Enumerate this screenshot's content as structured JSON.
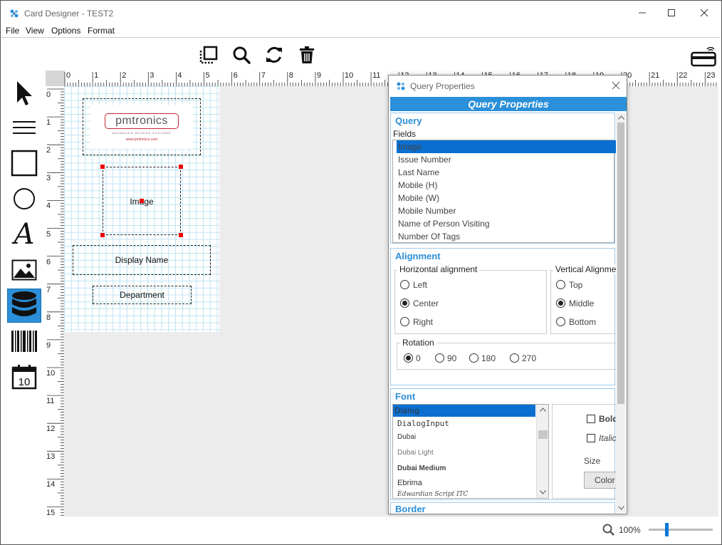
{
  "window": {
    "title": "Card Designer - TEST2"
  },
  "menu": [
    "File",
    "View",
    "Options",
    "Format"
  ],
  "toolbar": [
    "select-area-icon",
    "zoom-icon",
    "refresh-icon",
    "delete-icon"
  ],
  "tools": [
    "pointer",
    "lines",
    "rectangle",
    "ellipse",
    "text",
    "image",
    "database",
    "barcode",
    "calendar"
  ],
  "calendar_day": "10",
  "ruler": {
    "h": [
      "0",
      "1",
      "2",
      "3",
      "4",
      "5",
      "6",
      "7",
      "8",
      "9",
      "10",
      "11",
      "12",
      "13",
      "14",
      "15",
      "16",
      "17",
      "18",
      "19",
      "20",
      "21",
      "22",
      "23"
    ],
    "v": [
      "0",
      "1",
      "2",
      "3",
      "4",
      "5",
      "6",
      "7",
      "8",
      "9",
      "10",
      "11",
      "12",
      "13",
      "14",
      "15"
    ]
  },
  "card": {
    "logo_text": "pmtronics",
    "logo_tagline": "ADVANCED ACCESS SYSTEMS",
    "logo_url": "www.pmtronics.com",
    "image_label": "Image",
    "display_name_label": "Display Name",
    "department_label": "Department"
  },
  "dialog": {
    "title": "Query Properties",
    "header": "Query Properties",
    "query": {
      "title": "Query",
      "fields_label": "Fields",
      "fields": [
        "Image",
        "Issue Number",
        "Last Name",
        "Mobile (H)",
        "Mobile (W)",
        "Mobile Number",
        "Name of Person Visiting",
        "Number Of Tags"
      ],
      "selected": "Image"
    },
    "alignment": {
      "title": "Alignment",
      "horizontal_label": "Horizontal alignment",
      "horizontal_options": [
        "Left",
        "Center",
        "Right"
      ],
      "horizontal_selected": "Center",
      "vertical_label": "Vertical Alignme",
      "vertical_options": [
        "Top",
        "Middle",
        "Bottom"
      ],
      "vertical_selected": "Middle",
      "rotation_label": "Rotation",
      "rotation_options": [
        "0",
        "90",
        "180",
        "270"
      ],
      "rotation_selected": "0"
    },
    "font": {
      "title": "Font",
      "fonts": [
        "Dialog",
        "DialogInput",
        "Dubai",
        "Dubai Light",
        "Dubai Medium",
        "Ebrima",
        "Edwardian Script ITC"
      ],
      "selected": "Dialog",
      "bold_label": "Bold",
      "italic_label": "Italic",
      "size_label": "Size",
      "color_button": "Color"
    },
    "border": {
      "title": "Border"
    }
  },
  "status": {
    "zoom": "100%"
  },
  "colors": {
    "accent": "#2b8fd9",
    "selection": "#0a6fd1",
    "handle": "#e00000",
    "grid": "#bfe3f2"
  }
}
